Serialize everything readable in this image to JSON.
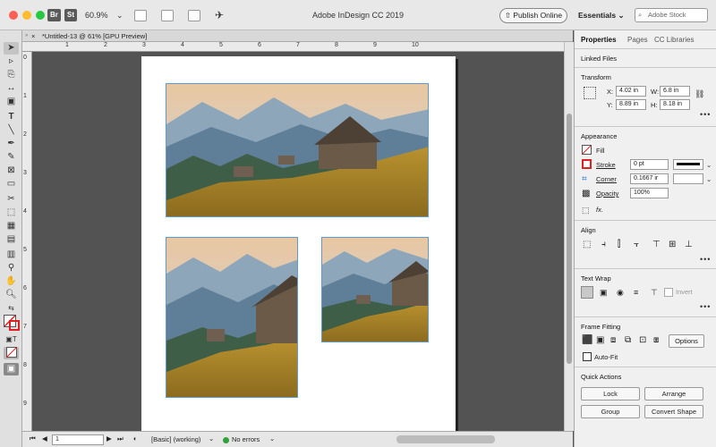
{
  "window": {
    "title": "Adobe InDesign CC 2019"
  },
  "titlebar": {
    "app_badges": [
      "Br",
      "St"
    ],
    "zoom": "60.9%",
    "publish_label": "Publish Online",
    "workspace": "Essentials",
    "search_placeholder": "Adobe Stock"
  },
  "document": {
    "tab_label": "*Untitled-13 @ 61% [GPU Preview]",
    "ruler_numbers": [
      "1",
      "2",
      "3",
      "4",
      "5",
      "6",
      "7",
      "8",
      "9",
      "10"
    ],
    "vruler_numbers": [
      "0",
      "1",
      "2",
      "3",
      "4",
      "5",
      "6",
      "7",
      "8",
      "9"
    ]
  },
  "status": {
    "page": "1",
    "preflight_profile": "[Basic] (working)",
    "errors": "No errors"
  },
  "panel": {
    "tabs": [
      "Properties",
      "Pages",
      "CC Libraries"
    ],
    "linked_files": "Linked Files",
    "transform": {
      "title": "Transform",
      "x_label": "X:",
      "x": "4.02 in",
      "y_label": "Y:",
      "y": "8.89 in",
      "w_label": "W:",
      "w": "6.8 in",
      "h_label": "H:",
      "h": "8.18 in"
    },
    "appearance": {
      "title": "Appearance",
      "fill": "Fill",
      "stroke": "Stroke",
      "stroke_value": "0 pt",
      "corner": "Corner",
      "corner_value": "0.1667 ir",
      "opacity": "Opacity",
      "opacity_value": "100%",
      "fx": "fx."
    },
    "align": {
      "title": "Align"
    },
    "text_wrap": {
      "title": "Text Wrap",
      "invert": "Invert"
    },
    "frame_fitting": {
      "title": "Frame Fitting",
      "options": "Options",
      "auto_fit": "Auto-Fit"
    },
    "quick_actions": {
      "title": "Quick Actions",
      "buttons": [
        "Lock",
        "Arrange",
        "Group",
        "Convert Shape"
      ]
    }
  }
}
